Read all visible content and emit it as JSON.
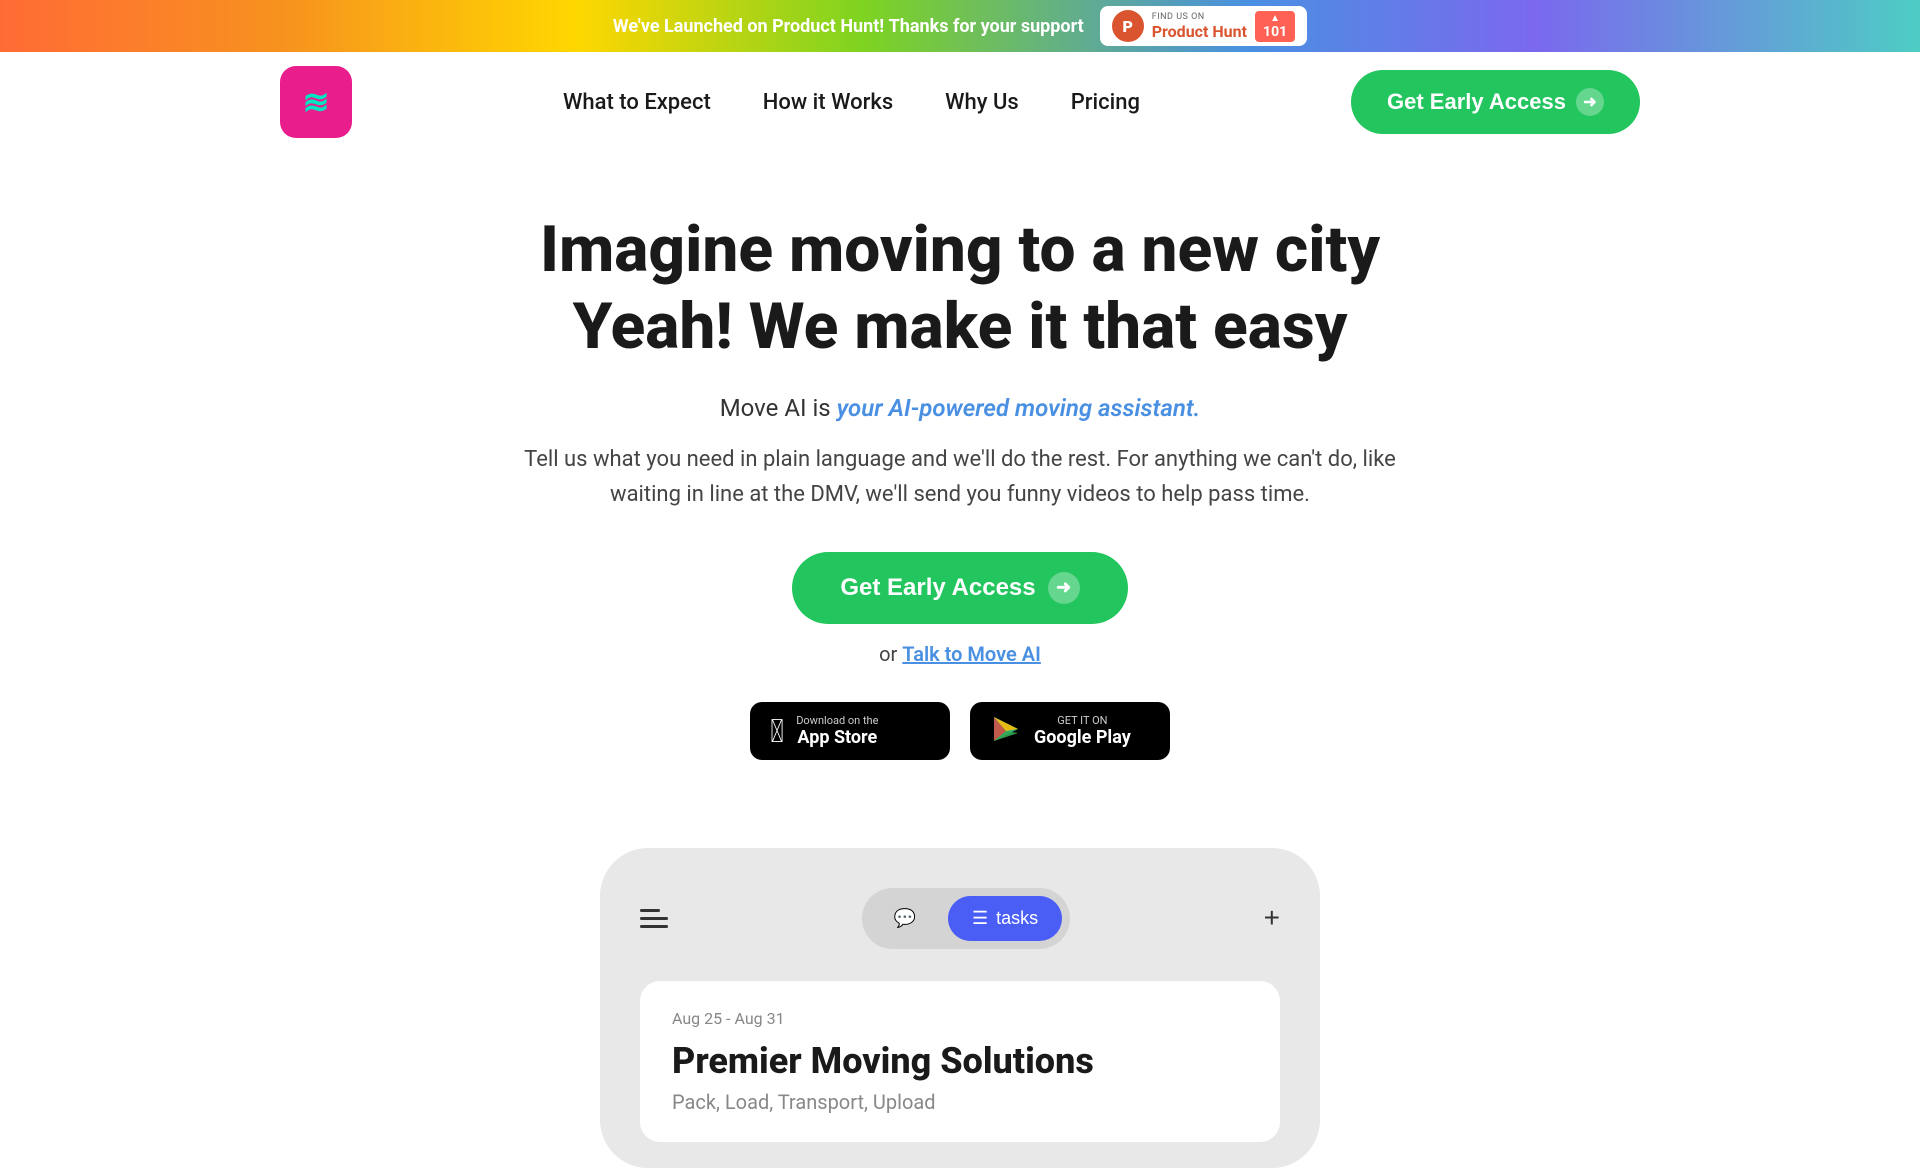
{
  "banner": {
    "text_bold": "We've Launched on Product Hunt!",
    "text_normal": " Thanks for your support",
    "ph_find": "FIND US ON",
    "ph_name": "Product Hunt",
    "ph_count": "101",
    "ph_arrow": "▲"
  },
  "navbar": {
    "logo_alt": "Move AI Logo",
    "links": [
      {
        "label": "What to Expect",
        "href": "#"
      },
      {
        "label": "How it Works",
        "href": "#"
      },
      {
        "label": "Why Us",
        "href": "#"
      },
      {
        "label": "Pricing",
        "href": "#"
      }
    ],
    "cta_label": "Get Early Access"
  },
  "hero": {
    "title_line1": "Imagine moving to a new city",
    "title_line2": "Yeah! We make it that easy",
    "subtitle_plain": "Move AI is ",
    "subtitle_accent": "your AI-powered moving assistant.",
    "description": "Tell us what you need in plain language and we'll do the rest. For anything we can't do, like waiting in line at the DMV, we'll send you funny videos to help pass time.",
    "cta_label": "Get Early Access",
    "talk_prefix": "or ",
    "talk_link": "Talk to Move AI"
  },
  "store_buttons": {
    "apple": {
      "small": "Download on the",
      "big": "App Store"
    },
    "google": {
      "small": "GET IT ON",
      "big": "Google Play"
    }
  },
  "phone_mockup": {
    "hamburger_label": "menu",
    "tab_chat": "chat",
    "tab_tasks": "tasks",
    "plus": "+",
    "card_date": "Aug 25 - Aug 31",
    "card_title": "Premier Moving Solutions",
    "card_subtitle": "Pack, Load, Transport, Upload"
  }
}
